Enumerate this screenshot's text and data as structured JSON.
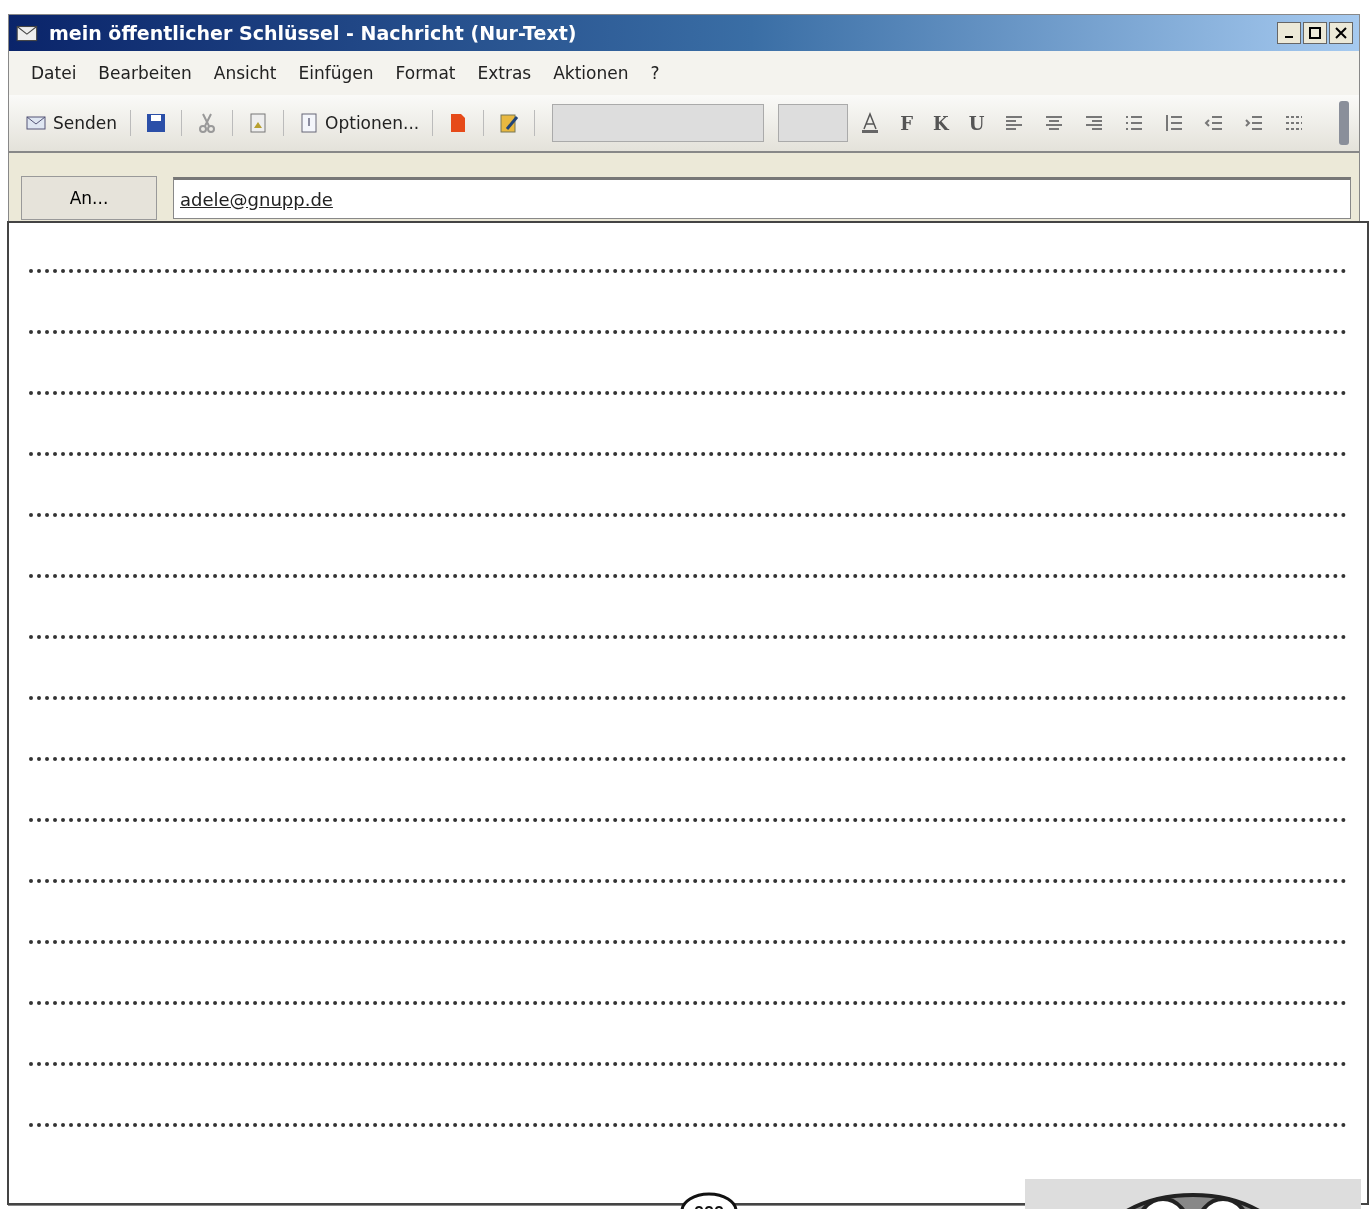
{
  "window": {
    "title": "mein öffentlicher Schlüssel - Nachricht (Nur-Text)"
  },
  "menu": [
    "Datei",
    "Bearbeiten",
    "Ansicht",
    "Einfügen",
    "Format",
    "Extras",
    "Aktionen",
    "?"
  ],
  "toolbar": [
    {
      "kind": "send",
      "label": "Senden"
    },
    {
      "kind": "save"
    },
    {
      "kind": "cut"
    },
    {
      "kind": "attach"
    },
    {
      "kind": "options",
      "label": "Optionen..."
    },
    {
      "kind": "flag"
    },
    {
      "kind": "edit"
    }
  ],
  "format_toolbar": [
    {
      "kind": "color"
    },
    {
      "kind": "text",
      "label": "F"
    },
    {
      "kind": "text",
      "label": "K"
    },
    {
      "kind": "text",
      "label": "U"
    },
    {
      "kind": "align-left"
    },
    {
      "kind": "align-center"
    },
    {
      "kind": "align-right"
    },
    {
      "kind": "bullets"
    },
    {
      "kind": "numbers"
    },
    {
      "kind": "outdent"
    },
    {
      "kind": "indent"
    },
    {
      "kind": "rule"
    }
  ],
  "recipient": {
    "button": "An...",
    "value": "adele@gnupp.de"
  },
  "body": {
    "lines": [
      {
        "kind": "dotted"
      },
      {
        "kind": "dotted"
      },
      {
        "kind": "dotted"
      },
      {
        "kind": "dotted"
      },
      {
        "kind": "dotted"
      },
      {
        "kind": "dotted"
      },
      {
        "kind": "dotted"
      },
      {
        "kind": "dotted"
      },
      {
        "kind": "dotted"
      },
      {
        "kind": "dotted"
      },
      {
        "kind": "dotted"
      },
      {
        "kind": "dotted"
      },
      {
        "kind": "dotted"
      },
      {
        "kind": "dotted"
      },
      {
        "kind": "dotted"
      }
    ]
  }
}
